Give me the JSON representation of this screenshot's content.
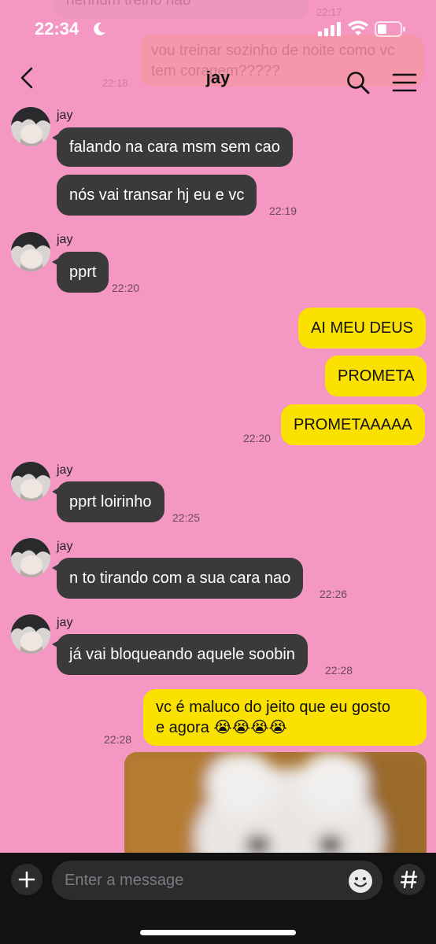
{
  "status_bar": {
    "time": "22:34"
  },
  "chat": {
    "title": "jay"
  },
  "ghost": {
    "top_msg": "nenhum treino nao",
    "top_time": "22:17",
    "msg2": "vou treinar sozinho de noite como vc tem coragem?????",
    "msg2_time": "22:18"
  },
  "messages": {
    "g1": {
      "sender": "jay",
      "b1": "falando na cara msm sem cao",
      "b2": "nós vai transar hj eu e vc",
      "time": "22:19"
    },
    "g2": {
      "sender": "jay",
      "b1": "pprt",
      "time": "22:20"
    },
    "g3": {
      "b1": "AI MEU DEUS",
      "b2": "PROMETA",
      "b3": "PROMETAAAAA",
      "time": "22:20"
    },
    "g4": {
      "sender": "jay",
      "b1": "pprt loirinho",
      "time": "22:25"
    },
    "g5": {
      "sender": "jay",
      "b1": "n to tirando com a sua cara nao",
      "time": "22:26"
    },
    "g6": {
      "sender": "jay",
      "b1": "já vai bloqueando aquele soobin",
      "time": "22:28"
    },
    "g7": {
      "line1": "vc é maluco do jeito que eu gosto",
      "line2": "e agora 😭😭😭😭",
      "time": "22:28"
    }
  },
  "composer": {
    "placeholder": "Enter a message"
  },
  "colors": {
    "background": "#f497c3",
    "incoming": "#3a3a3a",
    "outgoing": "#fbe100",
    "bottom_bar": "#121212"
  },
  "icons": [
    "moon-icon",
    "signal-icon",
    "wifi-icon",
    "battery-icon",
    "back-arrow-icon",
    "search-icon",
    "menu-icon",
    "plus-icon",
    "emoji-icon",
    "hash-icon"
  ]
}
